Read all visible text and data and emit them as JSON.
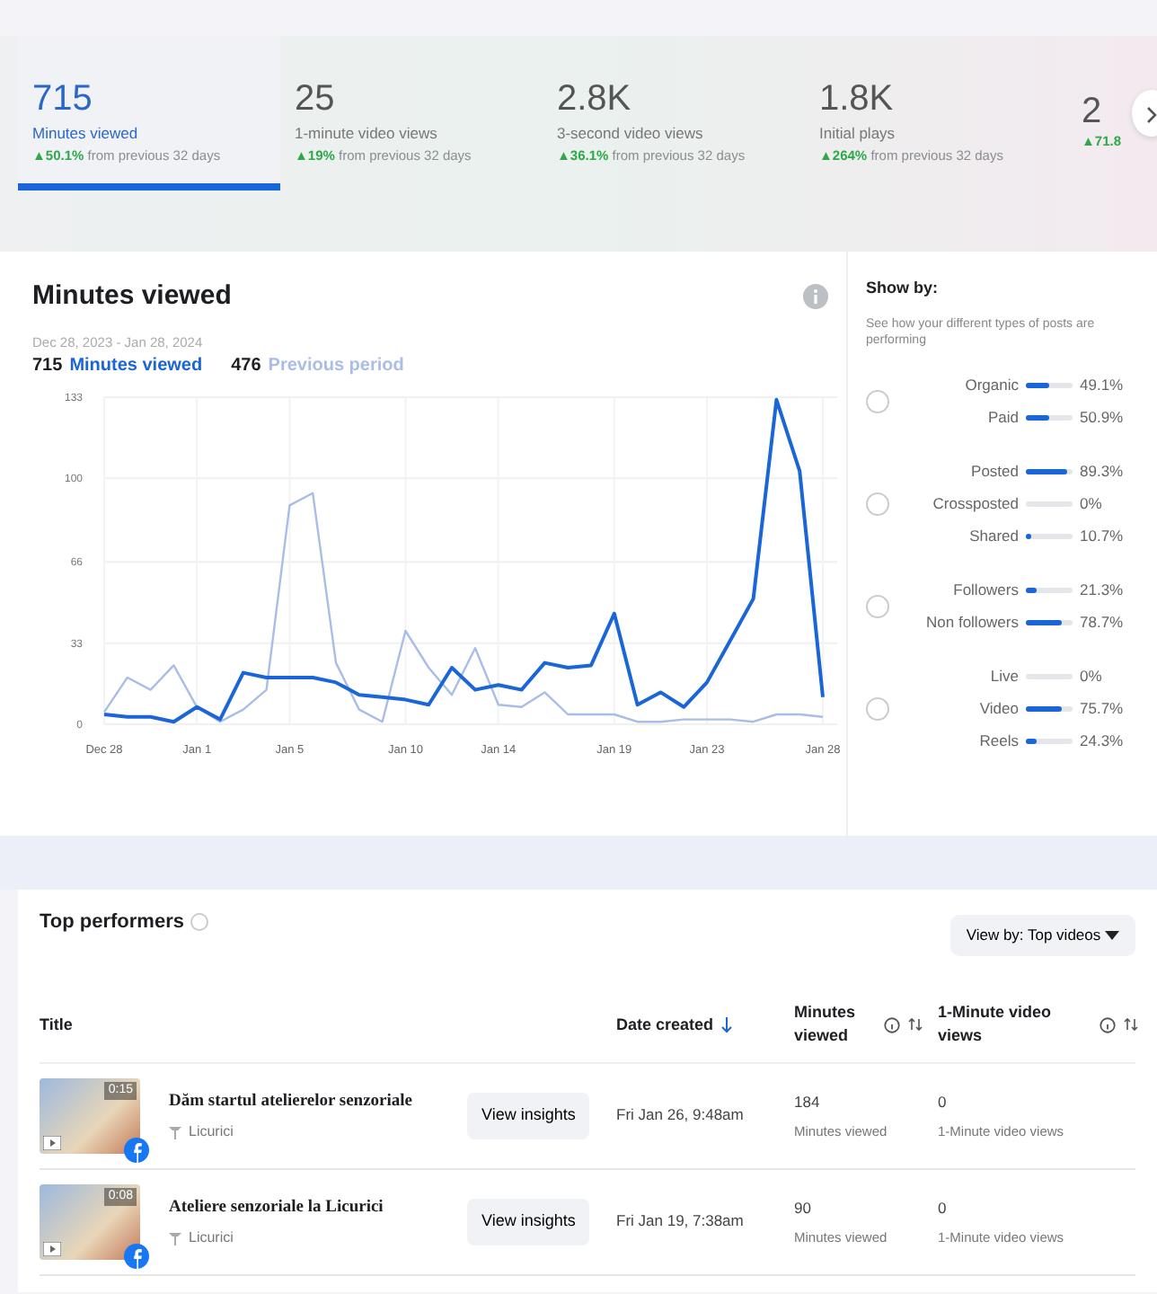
{
  "metric_tabs": [
    {
      "value": "715",
      "label": "Minutes viewed",
      "change": "▲50.1%",
      "change_note": "from previous 32 days",
      "selected": true
    },
    {
      "value": "25",
      "label": "1-minute video views",
      "change": "▲19%",
      "change_note": "from previous 32 days",
      "selected": false
    },
    {
      "value": "2.8K",
      "label": "3-second video views",
      "change": "▲36.1%",
      "change_note": "from previous 32 days",
      "selected": false
    },
    {
      "value": "1.8K",
      "label": "Initial plays",
      "change": "▲264%",
      "change_note": "from previous 32 days",
      "selected": false
    },
    {
      "value": "2",
      "change": "▲71.8",
      "selected": false
    }
  ],
  "chart_panel": {
    "title": "Minutes viewed",
    "date_range": "Dec 28, 2023 - Jan 28, 2024",
    "legend": [
      {
        "value": "715"
      },
      {
        "value": "476"
      }
    ],
    "chart_data": {
      "type": "line",
      "grid": true,
      "categories": [
        "Dec 28",
        null,
        null,
        null,
        "Jan 1",
        null,
        null,
        null,
        "Jan 5",
        null,
        null,
        null,
        null,
        "Jan 10",
        null,
        null,
        null,
        "Jan 14",
        null,
        null,
        null,
        null,
        "Jan 19",
        null,
        null,
        null,
        "Jan 23",
        null,
        null,
        null,
        null,
        "Jan 28"
      ],
      "yticks": [
        0,
        33,
        66,
        100,
        133
      ],
      "ylim": [
        0,
        133
      ],
      "series": [
        {
          "name": "Minutes viewed",
          "color": "#1a66d9",
          "values": [
            4,
            3,
            3,
            1,
            7,
            2,
            21,
            19,
            19,
            19,
            17,
            12,
            11,
            10,
            8,
            23,
            14,
            16,
            14,
            25,
            23,
            24,
            45,
            8,
            13,
            7,
            17,
            34,
            51,
            132,
            103,
            11
          ]
        },
        {
          "name": "Previous period",
          "color": "#a9bde8",
          "values": [
            5,
            19,
            14,
            24,
            7,
            1,
            6,
            14,
            89,
            94,
            25,
            6,
            1,
            38,
            23,
            12,
            31,
            8,
            7,
            13,
            4,
            4,
            4,
            1,
            1,
            2,
            2,
            2,
            1,
            4,
            4,
            3
          ]
        }
      ]
    }
  },
  "show_by": {
    "title": "Show by:",
    "description": "See how your different types of posts are performing",
    "groups": [
      {
        "selected": false,
        "rows": [
          {
            "label": "Organic",
            "level": 0.491,
            "reading": "49.1%"
          },
          {
            "label": "Paid",
            "level": 0.509,
            "reading": "50.9%"
          }
        ]
      },
      {
        "selected": false,
        "rows": [
          {
            "label": "Posted",
            "level": 0.893,
            "reading": "89.3%"
          },
          {
            "label": "Crossposted",
            "level": 0,
            "reading": "0%"
          },
          {
            "label": "Shared",
            "level": 0.107,
            "reading": "10.7%"
          }
        ]
      },
      {
        "selected": false,
        "rows": [
          {
            "label": "Followers",
            "level": 0.213,
            "reading": "21.3%"
          },
          {
            "label": "Non followers",
            "level": 0.787,
            "reading": "78.7%"
          }
        ]
      },
      {
        "selected": false,
        "rows": [
          {
            "label": "Live",
            "level": 0,
            "reading": "0%"
          },
          {
            "label": "Video",
            "level": 0.757,
            "reading": "75.7%"
          },
          {
            "label": "Reels",
            "level": 0.243,
            "reading": "24.3%"
          }
        ]
      }
    ]
  },
  "top_performers": {
    "title": "Top performers",
    "view_by": "View by: Top videos",
    "columns": [
      "Title",
      "Date created",
      "Minutes viewed",
      "1-Minute video views"
    ],
    "rows": [
      {
        "duration": "0:15",
        "title": "Dăm startul atelierelor senzoriale",
        "page": "Licurici",
        "action": "View insights",
        "date": "Fri Jan 26, 9:48am",
        "minutes": "184",
        "minutes_label": "Minutes viewed",
        "views": "0",
        "views_label": "1-Minute video views"
      },
      {
        "duration": "0:08",
        "title": "Ateliere senzoriale la Licurici",
        "page": "Licurici",
        "action": "View insights",
        "date": "Fri Jan 19, 7:38am",
        "minutes": "90",
        "minutes_label": "Minutes viewed",
        "views": "0",
        "views_label": "1-Minute video views"
      }
    ]
  }
}
